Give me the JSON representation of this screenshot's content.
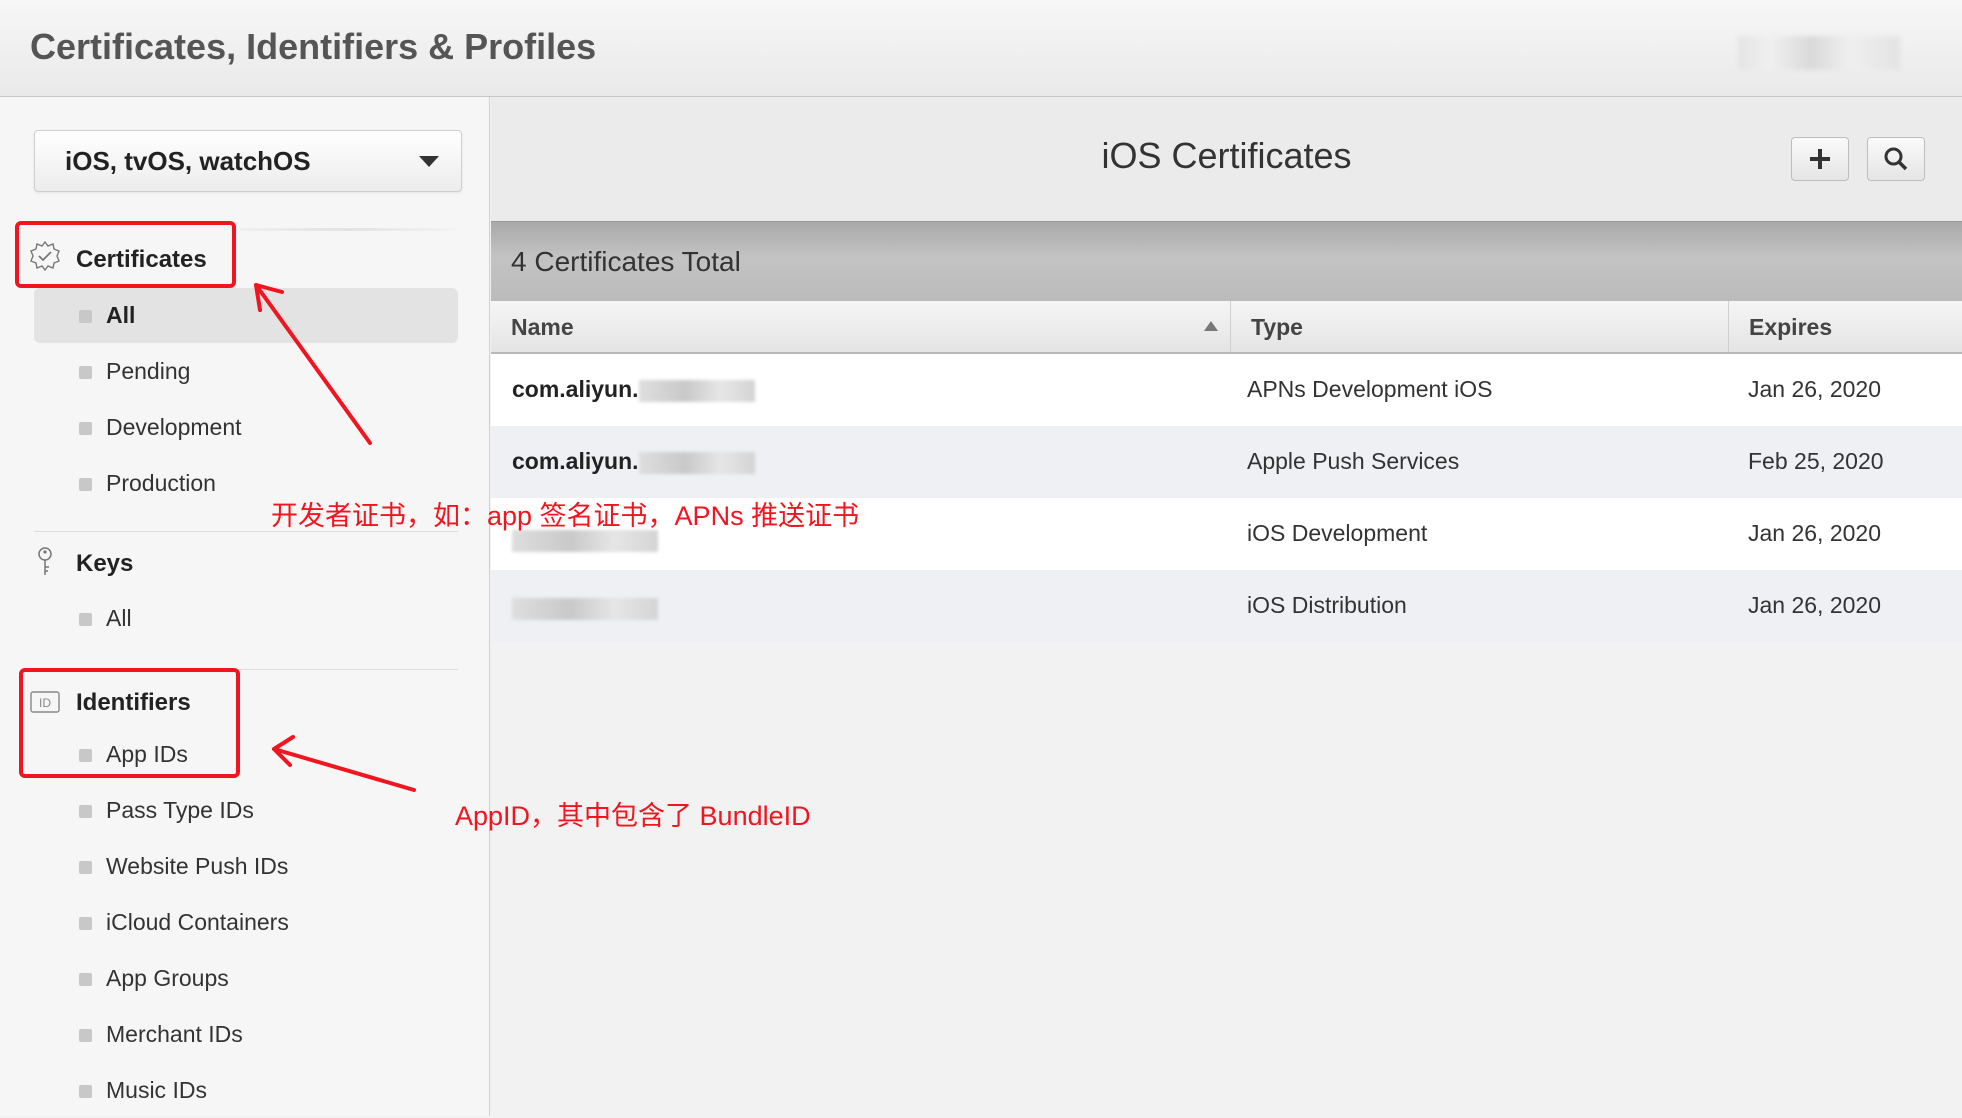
{
  "header": {
    "title": "Certificates, Identifiers & Profiles"
  },
  "sidebar": {
    "platform_select": "iOS, tvOS, watchOS",
    "sections": [
      {
        "title": "Certificates",
        "icon": "certificate-seal-icon",
        "items": [
          "All",
          "Pending",
          "Development",
          "Production"
        ],
        "active_item": "All"
      },
      {
        "title": "Keys",
        "icon": "key-icon",
        "items": [
          "All"
        ]
      },
      {
        "title": "Identifiers",
        "icon": "id-icon",
        "items": [
          "App IDs",
          "Pass Type IDs",
          "Website Push IDs",
          "iCloud Containers",
          "App Groups",
          "Merchant IDs",
          "Music IDs"
        ]
      }
    ]
  },
  "main": {
    "title": "iOS Certificates",
    "add_icon": "plus-icon",
    "search_icon": "search-icon",
    "count_text": "4 Certificates Total",
    "columns": [
      "Name",
      "Type",
      "Expires"
    ],
    "sort": {
      "column": "Name",
      "direction": "ascending"
    },
    "rows": [
      {
        "name": "com.aliyun.",
        "type": "APNs Development iOS",
        "expires": "Jan 26, 2020"
      },
      {
        "name": "com.aliyun.",
        "type": "Apple Push Services",
        "expires": "Feb 25, 2020"
      },
      {
        "name": "",
        "type": "iOS Development",
        "expires": "Jan 26, 2020"
      },
      {
        "name": "",
        "type": "iOS Distribution",
        "expires": "Jan 26, 2020"
      }
    ]
  },
  "annotations": {
    "certificates_note": "开发者证书，如：app 签名证书，APNs 推送证书",
    "identifiers_note": "AppID，其中包含了 BundleID",
    "highlight_color": "#f2141e"
  }
}
